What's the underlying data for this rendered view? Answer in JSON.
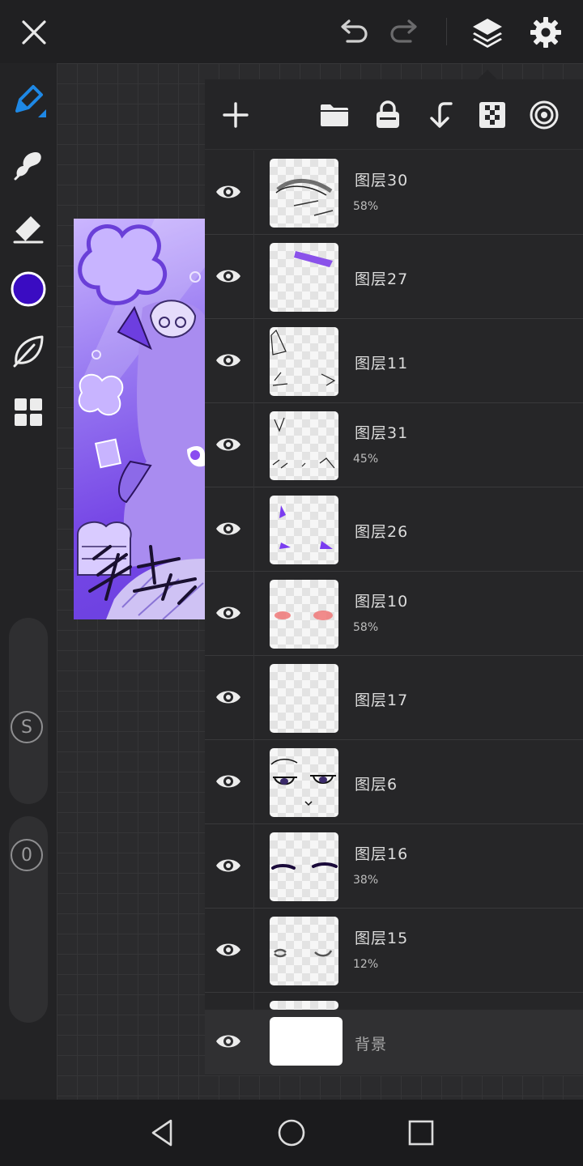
{
  "toolbar": {
    "close": "close-icon",
    "undo": "undo-icon",
    "redo": "redo-icon",
    "layers": "layers-icon",
    "settings": "gear-icon"
  },
  "tools": {
    "brush": "pen-icon",
    "smudge": "smudge-icon",
    "eraser": "eraser-icon",
    "color": "#3a0cc2",
    "blend": "leaf-icon",
    "more": "grid-icon"
  },
  "sliders": {
    "size_label": "S",
    "opacity_label": "0"
  },
  "layers_panel": {
    "add": "plus-icon",
    "folder": "folder-icon",
    "lock": "lock-icon",
    "merge_down": "merge-down-icon",
    "alpha": "checker-icon",
    "mask": "target-icon"
  },
  "layers": [
    {
      "name": "图层30",
      "opacity": "58%"
    },
    {
      "name": "图层27",
      "opacity": ""
    },
    {
      "name": "图层11",
      "opacity": ""
    },
    {
      "name": "图层31",
      "opacity": "45%"
    },
    {
      "name": "图层26",
      "opacity": ""
    },
    {
      "name": "图层10",
      "opacity": "58%"
    },
    {
      "name": "图层17",
      "opacity": ""
    },
    {
      "name": "图层6",
      "opacity": ""
    },
    {
      "name": "图层16",
      "opacity": "38%"
    },
    {
      "name": "图层15",
      "opacity": "12%"
    }
  ],
  "background_layer": {
    "name": "背景"
  },
  "colors": {
    "accent": "#1e88e5",
    "art_purple": "#7748e6",
    "blush": "#f07878"
  }
}
